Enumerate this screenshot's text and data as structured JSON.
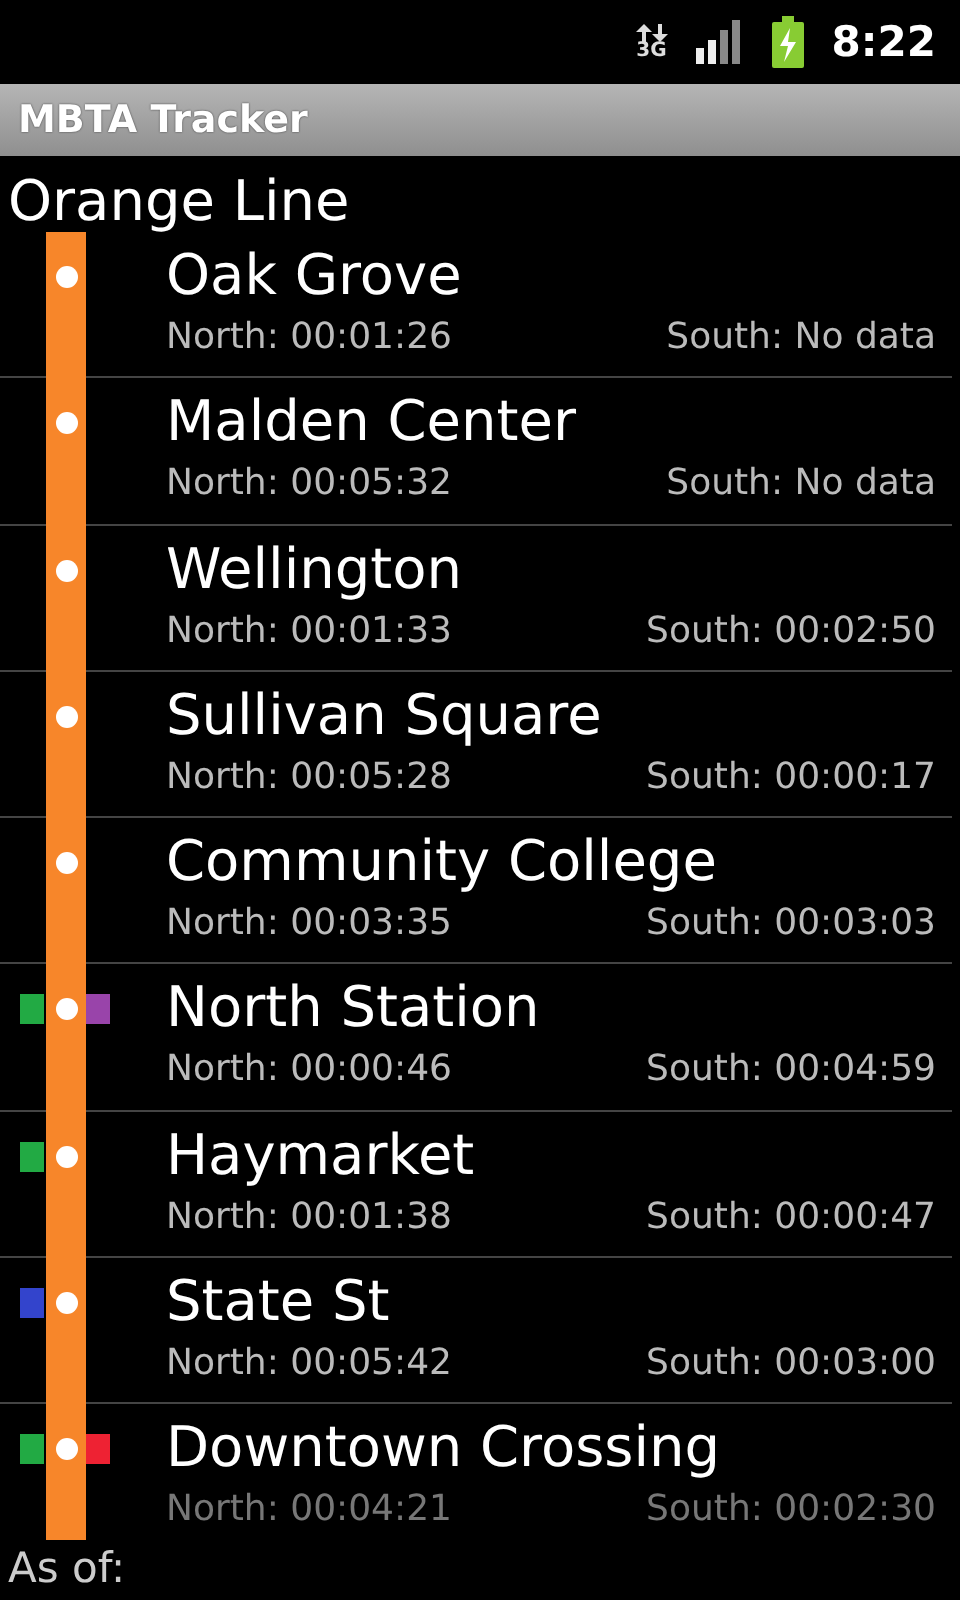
{
  "status_bar": {
    "network": "3G",
    "time": "8:22"
  },
  "title_bar": {
    "title": "MBTA Tracker"
  },
  "line": {
    "name": "Orange Line",
    "color": "#f7862a"
  },
  "stations": [
    {
      "name": "Oak Grove",
      "north": "North: 00:01:26",
      "south": "South: No data"
    },
    {
      "name": "Malden Center",
      "north": "North: 00:05:32",
      "south": "South: No data"
    },
    {
      "name": "Wellington",
      "north": "North: 00:01:33",
      "south": "South: 00:02:50"
    },
    {
      "name": "Sullivan Square",
      "north": "North: 00:05:28",
      "south": "South: 00:00:17"
    },
    {
      "name": "Community College",
      "north": "North: 00:03:35",
      "south": "South: 00:03:03"
    },
    {
      "name": "North Station",
      "north": "North: 00:00:46",
      "south": "South: 00:04:59",
      "left_transfer": {
        "color": "#22aa44"
      },
      "right_transfer": {
        "color": "#9944aa"
      }
    },
    {
      "name": "Haymarket",
      "north": "North: 00:01:38",
      "south": "South: 00:00:47",
      "left_transfer": {
        "color": "#22aa44"
      }
    },
    {
      "name": "State St",
      "north": "North: 00:05:42",
      "south": "South: 00:03:00",
      "left_transfer": {
        "color": "#3344cc"
      }
    },
    {
      "name": "Downtown Crossing",
      "north": "North: 00:04:21",
      "south": "South: 00:02:30",
      "left_transfer": {
        "color": "#22aa44"
      },
      "right_transfer": {
        "color": "#ee2233"
      }
    }
  ],
  "footer": {
    "label": "As of:"
  }
}
